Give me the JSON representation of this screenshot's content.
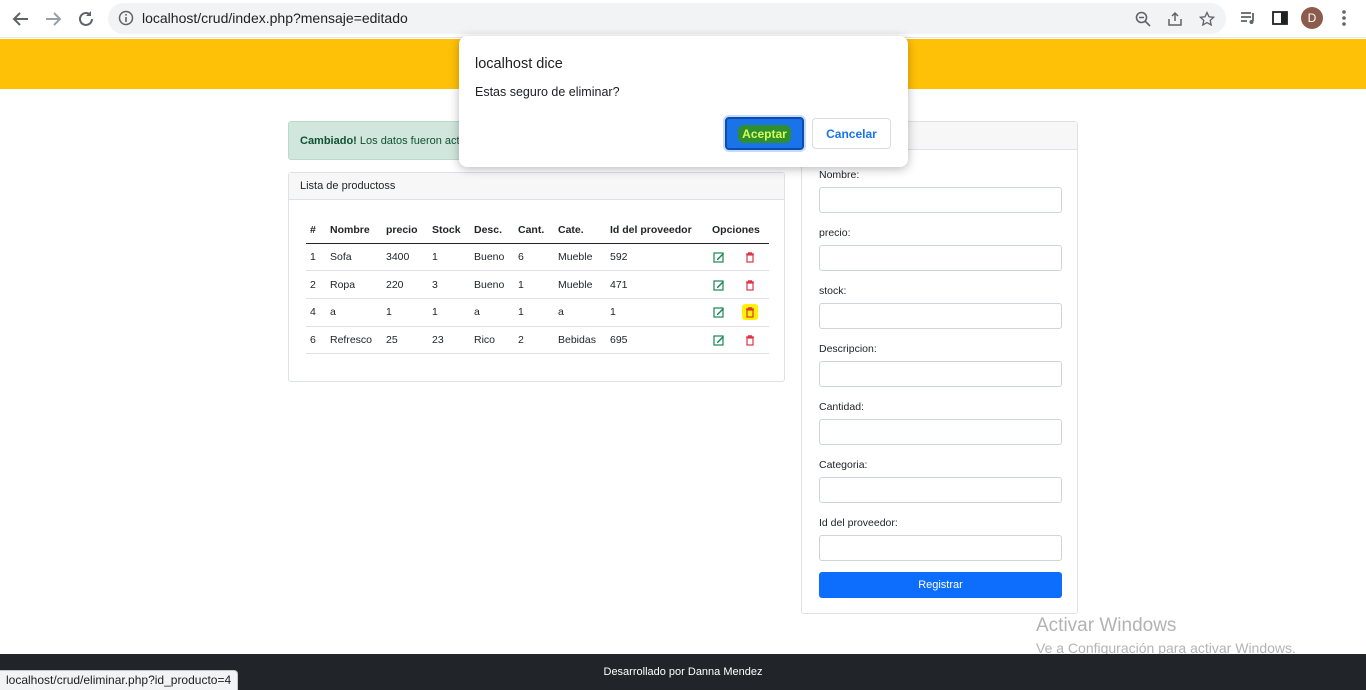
{
  "browser": {
    "url": "localhost/crud/index.php?mensaje=editado",
    "profile_initial": "D",
    "status_url": "localhost/crud/eliminar.php?id_producto=4"
  },
  "alert": {
    "strong": "Cambiado!",
    "text": " Los datos fueron actualizados."
  },
  "product_list": {
    "header": "Lista de productoss",
    "columns": [
      "#",
      "Nombre",
      "precio",
      "Stock",
      "Desc.",
      "Cant.",
      "Cate.",
      "Id del proveedor",
      "Opciones"
    ],
    "rows": [
      [
        "1",
        "Sofa",
        "3400",
        "1",
        "Bueno",
        "6",
        "Mueble",
        "592"
      ],
      [
        "2",
        "Ropa",
        "220",
        "3",
        "Bueno",
        "1",
        "Mueble",
        "471"
      ],
      [
        "4",
        "a",
        "1",
        "1",
        "a",
        "1",
        "a",
        "1"
      ],
      [
        "6",
        "Refresco",
        "25",
        "23",
        "Rico",
        "2",
        "Bebidas",
        "695"
      ]
    ]
  },
  "form": {
    "labels": [
      "Nombre:",
      "precio:",
      "stock:",
      "Descripcion:",
      "Cantidad:",
      "Categoria:",
      "Id del proveedor:"
    ],
    "submit_label": "Registrar"
  },
  "dialog": {
    "title": "localhost dice",
    "message": "Estas seguro de eliminar?",
    "ok_label": "Aceptar",
    "cancel_label": "Cancelar"
  },
  "watermark": {
    "line1": "Activar Windows",
    "line2": "Ve a Configuración para activar Windows."
  },
  "footer": {
    "text": "Desarrollado por Danna Mendez"
  },
  "colors": {
    "topbar": "#ffc107",
    "primary": "#0d6efd",
    "alert_bg": "#d1e7dd",
    "footer_bg": "#212529"
  }
}
